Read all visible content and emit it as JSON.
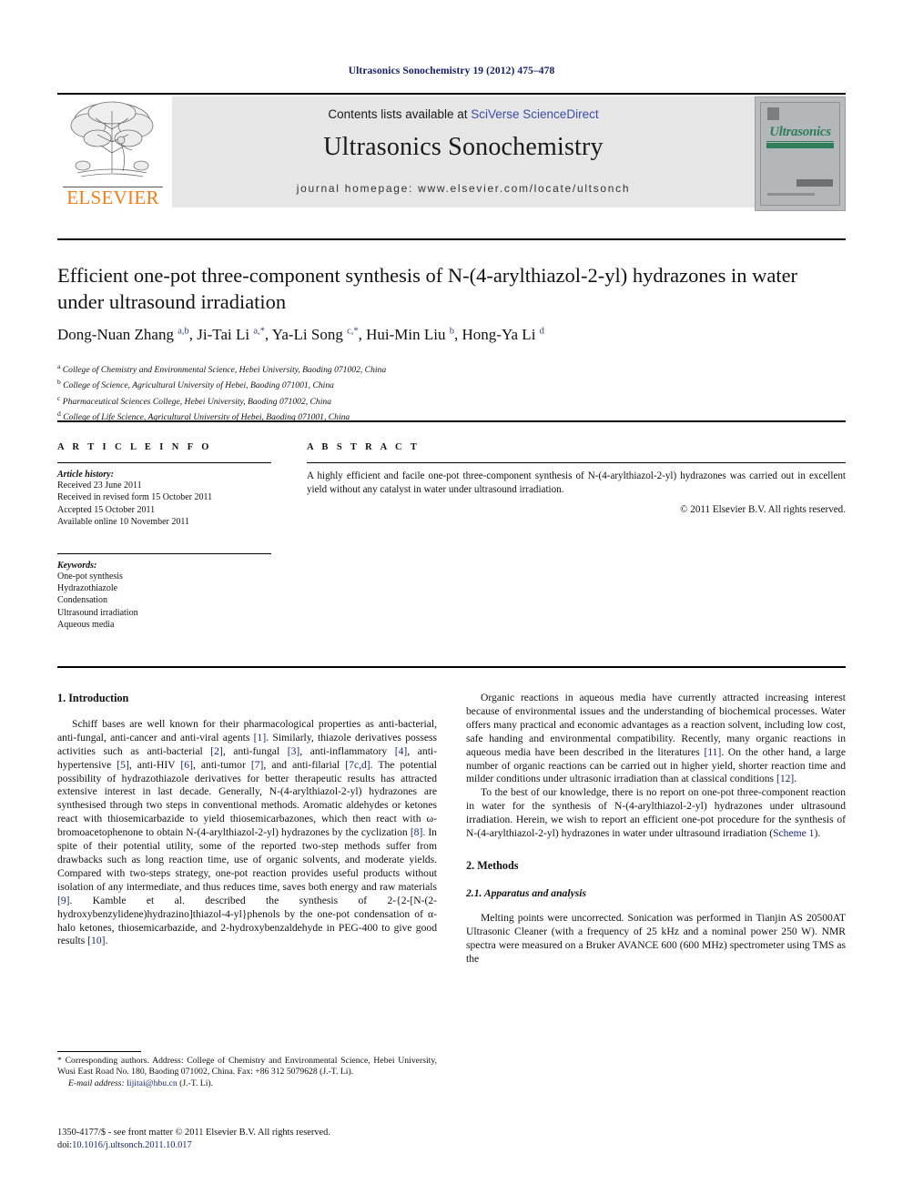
{
  "running_head": "Ultrasonics Sonochemistry 19 (2012) 475–478",
  "masthead": {
    "contents_prefix": "Contents lists available at ",
    "contents_link": "SciVerse ScienceDirect",
    "journal_title": "Ultrasonics Sonochemistry",
    "homepage": "journal homepage: www.elsevier.com/locate/ultsonch",
    "publisher_wordmark": "ELSEVIER",
    "cover": {
      "title": "Ultrasonics",
      "subtitle": "SONOCHEMISTRY"
    }
  },
  "article": {
    "title": "Efficient one-pot three-component synthesis of N-(4-arylthiazol-2-yl) hydrazones in water under ultrasound irradiation",
    "authors_html": "Dong-Nuan Zhang <sup>a,b</sup>, Ji-Tai Li <sup>a,</sup><sup>*</sup>, Ya-Li Song <sup>c,</sup><sup>*</sup>, Hui-Min Liu <sup>b</sup>, Hong-Ya Li <sup>d</sup>",
    "affiliations": [
      {
        "marker": "a",
        "text": "College of Chemistry and Environmental Science, Hebei University, Baoding 071002, China"
      },
      {
        "marker": "b",
        "text": "College of Science, Agricultural University of Hebei, Baoding 071001, China"
      },
      {
        "marker": "c",
        "text": "Pharmaceutical Sciences College, Hebei University, Baoding 071002, China"
      },
      {
        "marker": "d",
        "text": "College of Life Science, Agricultural University of Hebei, Baoding 071001, China"
      }
    ]
  },
  "info": {
    "heading": "A R T I C L E    I N F O",
    "history_label": "Article history:",
    "history": [
      "Received 23 June 2011",
      "Received in revised form 15 October 2011",
      "Accepted 15 October 2011",
      "Available online 10 November 2011"
    ],
    "keywords_label": "Keywords:",
    "keywords": [
      "One-pot synthesis",
      "Hydrazothiazole",
      "Condensation",
      "Ultrasound irradiation",
      "Aqueous media"
    ]
  },
  "abstract": {
    "heading": "A B S T R A C T",
    "text": "A highly efficient and facile one-pot three-component synthesis of N-(4-arylthiazol-2-yl) hydrazones was carried out in excellent yield without any catalyst in water under ultrasound irradiation.",
    "copyright": "© 2011 Elsevier B.V. All rights reserved."
  },
  "body": {
    "intro_heading": "1. Introduction",
    "intro_p1_html": "Schiff bases are well known for their pharmacological properties as anti-bacterial, anti-fungal, anti-cancer and anti-viral agents <span class=\"cite\">[1]</span>. Similarly, thiazole derivatives possess activities such as anti-bacterial <span class=\"cite\">[2]</span>, anti-fungal <span class=\"cite\">[3]</span>, anti-inflammatory <span class=\"cite\">[4]</span>, anti-hypertensive <span class=\"cite\">[5]</span>, anti-HIV <span class=\"cite\">[6]</span>, anti-tumor <span class=\"cite\">[7]</span>, and anti-filarial <span class=\"cite\">[7c,d]</span>. The potential possibility of hydrazothiazole derivatives for better therapeutic results has attracted extensive interest in last decade. Generally, N-(4-arylthiazol-2-yl) hydrazones are synthesised through two steps in conventional methods. Aromatic aldehydes or ketones react with thiosemicarbazide to yield thiosemicarbazones, which then react with ω-bromoacetophenone to obtain N-(4-arylthiazol-2-yl) hydrazones by the cyclization <span class=\"cite\">[8]</span>. In spite of their potential utility, some of the reported two-step methods suffer from drawbacks such as long reaction time, use of organic solvents, and moderate yields. Compared with two-steps strategy, one-pot reaction provides useful products without isolation of any intermediate, and thus reduces time, saves both energy and raw materials <span class=\"cite\">[9]</span>. Kamble et al. described the synthesis of 2-{2-[N-(2-hydroxybenzylidene)hydrazino]thiazol-4-yl}phenols by the one-pot condensation of α-halo ketones, thiosemicarbazide, and 2-hydroxybenzaldehyde in PEG-400 to give good results <span class=\"cite\">[10]</span>.",
    "intro_p2_html": "Organic reactions in aqueous media have currently attracted increasing interest because of environmental issues and the understanding of biochemical processes. Water offers many practical and economic advantages as a reaction solvent, including low cost, safe handing and environmental compatibility. Recently, many organic reactions in aqueous media have been described in the literatures <span class=\"cite\">[11]</span>. On the other hand, a large number of organic reactions can be carried out in higher yield, shorter reaction time and milder conditions under ultrasonic irradiation than at classical conditions <span class=\"cite\">[12]</span>.",
    "intro_p3_html": "To the best of our knowledge, there is no report on one-pot three-component reaction in water for the synthesis of N-(4-arylthiazol-2-yl) hydrazones under ultrasound irradiation. Herein, we wish to report an efficient one-pot procedure for the synthesis of N-(4-arylthiazol-2-yl) hydrazones in water under ultrasound irradiation (<span class=\"cite\">Scheme 1</span>).",
    "methods_heading": "2. Methods",
    "apparatus_heading": "2.1. Apparatus and analysis",
    "apparatus_p_html": "Melting points were uncorrected. Sonication was performed in Tianjin AS 20500AT Ultrasonic Cleaner (with a frequency of 25 kHz and a nominal power 250 W). NMR spectra were measured on a Bruker AVANCE 600 (600 MHz) spectrometer using TMS as the"
  },
  "footnote": {
    "corresponding_html": "* Corresponding authors. Address: College of Chemistry and Environmental Science, Hebei University, Wusi East Road No. 180, Baoding 071002, China. Fax: +86 312 5079628 (J.-T. Li).",
    "email_label": "E-mail address:",
    "email": "lijitai@hbu.cn",
    "email_suffix": "(J.-T. Li)."
  },
  "imprint": {
    "line1": "1350-4177/$ - see front matter © 2011 Elsevier B.V. All rights reserved.",
    "doi_label": "doi:",
    "doi": "10.1016/j.ultsonch.2011.10.017"
  }
}
